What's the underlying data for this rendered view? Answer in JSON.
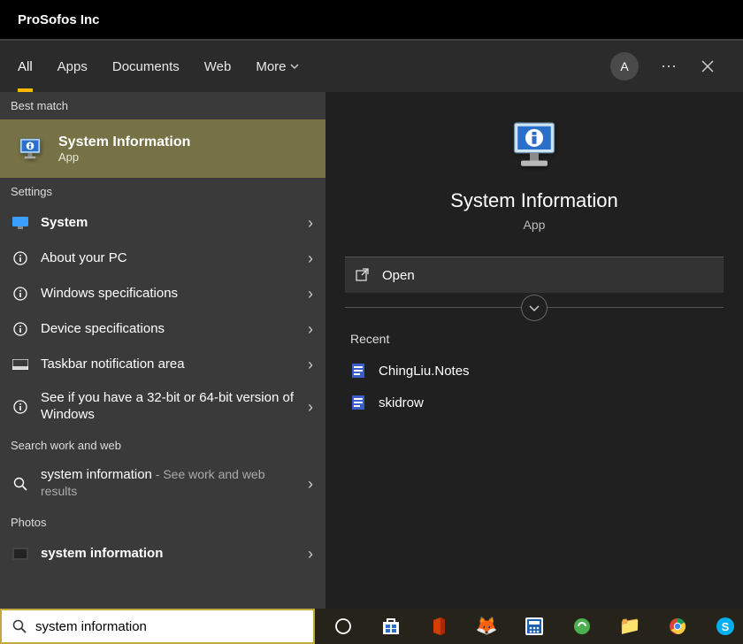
{
  "titlebar": {
    "text": "ProSofos Inc"
  },
  "tabs": {
    "items": [
      "All",
      "Apps",
      "Documents",
      "Web",
      "More"
    ],
    "active_index": 0,
    "avatar_letter": "A"
  },
  "left": {
    "best_match_label": "Best match",
    "match": {
      "title": "System Information",
      "subtitle": "App"
    },
    "settings_label": "Settings",
    "settings_items": [
      {
        "icon": "monitor",
        "text": "System"
      },
      {
        "icon": "info",
        "text": "About your PC"
      },
      {
        "icon": "info",
        "text": "Windows specifications"
      },
      {
        "icon": "info",
        "text": "Device specifications"
      },
      {
        "icon": "taskbar",
        "text": "Taskbar notification area"
      },
      {
        "icon": "info",
        "text": "See if you have a 32-bit or 64-bit version of Windows"
      }
    ],
    "work_web_label": "Search work and web",
    "work_web_item": {
      "main": "system information",
      "sub": " - See work and web results"
    },
    "photos_label": "Photos",
    "photos_item": "system information"
  },
  "right": {
    "title": "System Information",
    "subtitle": "App",
    "open_label": "Open",
    "recent_label": "Recent",
    "recent_items": [
      "ChingLiu.Notes",
      "skidrow"
    ]
  },
  "search": {
    "value": "system information"
  }
}
